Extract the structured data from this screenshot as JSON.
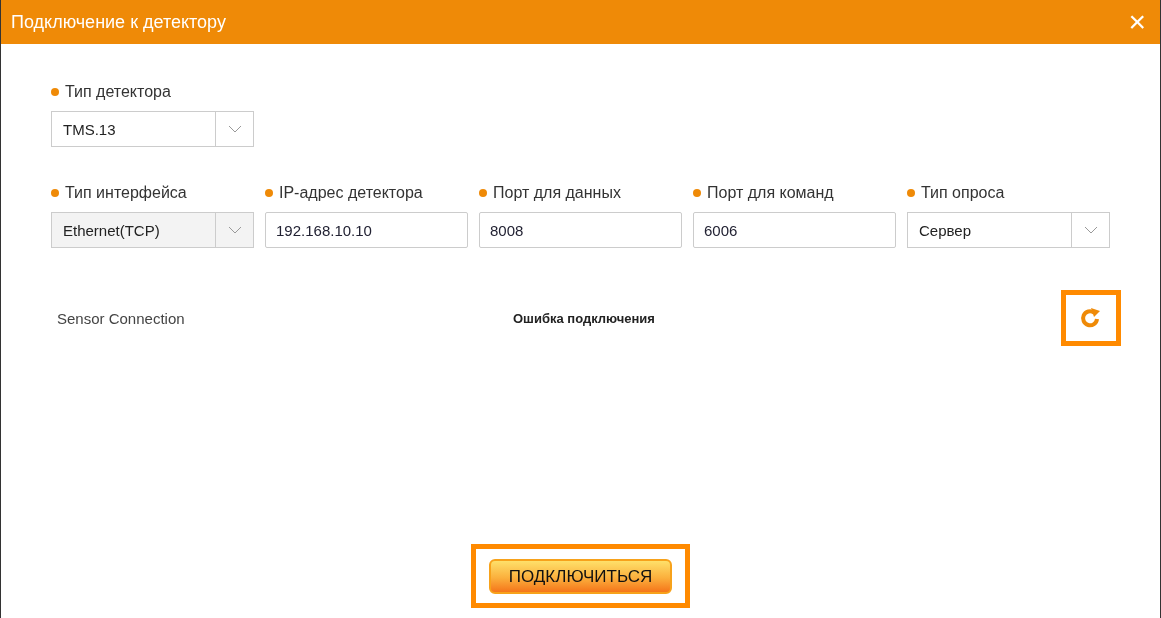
{
  "window": {
    "title": "Подключение к детектору",
    "close": "×"
  },
  "detector_type": {
    "label": "Тип детектора",
    "kind": "select",
    "value": "TMS.13",
    "disabled": false
  },
  "fields": [
    {
      "label": "Тип интерфейса",
      "kind": "select",
      "value": "Ethernet(TCP)",
      "disabled": true
    },
    {
      "label": "IP-адрес детектора",
      "kind": "input",
      "value": "192.168.10.10",
      "disabled": false
    },
    {
      "label": "Порт для данных",
      "kind": "input",
      "value": "8008",
      "disabled": false
    },
    {
      "label": "Порт для команд",
      "kind": "input",
      "value": "6006",
      "disabled": false
    },
    {
      "label": "Тип опроса",
      "kind": "select",
      "value": "Сервер",
      "disabled": false
    }
  ],
  "status": {
    "name": "Sensor Connection",
    "message": "Ошибка подключения",
    "refresh_highlighted": true
  },
  "connect_button": {
    "label": "ПОДКЛЮЧИТЬСЯ",
    "highlighted": true
  }
}
